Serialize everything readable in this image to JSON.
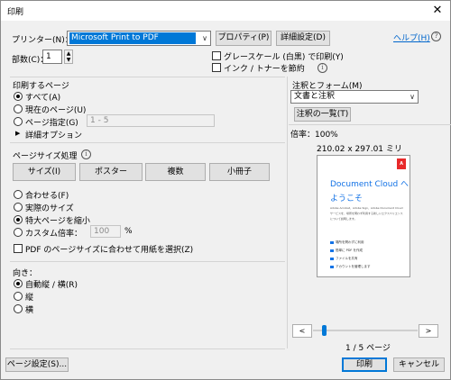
{
  "window": {
    "title": "印刷"
  },
  "printer": {
    "label": "プリンター(N)：",
    "selected": "Microsoft Print to PDF",
    "properties_button": "プロパティ(P)",
    "advanced_button": "詳細設定(D)",
    "help_link": "ヘルプ(H)"
  },
  "copies": {
    "label": "部数(C)：",
    "value": "1"
  },
  "options": {
    "grayscale": "グレースケール (白黒) で印刷(Y)",
    "save_ink": "インク / トナーを節約"
  },
  "pages_to_print": {
    "heading": "印刷するページ",
    "all": "すべて(A)",
    "current": "現在のページ(U)",
    "range": "ページ指定(G)",
    "range_placeholder": "1 - 5",
    "more_options": "詳細オプション"
  },
  "page_sizing": {
    "heading": "ページサイズ処理",
    "tabs": [
      "サイズ(I)",
      "ポスター",
      "複数",
      "小冊子"
    ],
    "fit": "合わせる(F)",
    "actual_size": "実際のサイズ",
    "shrink_oversized": "特大ページを縮小",
    "custom_scale": "カスタム倍率：",
    "custom_scale_value": "100",
    "percent": "%",
    "choose_paper": "PDF のページサイズに合わせて用紙を選択(Z)"
  },
  "orientation": {
    "heading": "向き：",
    "auto": "自動縦 / 横(R)",
    "portrait": "縦",
    "landscape": "横"
  },
  "comments_forms": {
    "heading": "注釈とフォーム(M)",
    "selected": "文書と注釈",
    "summarize_button": "注釈の一覧(T)"
  },
  "preview": {
    "scale": "倍率：100%",
    "dimensions": "210.02 x 297.01 ミリ",
    "page_indicator": "1 / 5 ページ",
    "doc_title_line1": "Document Cloud へ",
    "doc_title_line2": "ようこそ",
    "doc_text1": "Adobe Acrobat、Adobe Sign、Adobe Document Cloud",
    "doc_text2": "サービスを、場所を問わず利用する新しいエクスペリエンス",
    "doc_text3": "について説明します。",
    "doc_items": [
      "場所を問わずに利用",
      "簡単に PDF を作成",
      "ファイルを共有",
      "アカウントを管理します"
    ],
    "prev_icon": "<",
    "next_icon": ">",
    "logo_text": "A"
  },
  "footer": {
    "page_setup": "ページ設定(S)...",
    "print": "印刷",
    "cancel": "キャンセル"
  },
  "colors": {
    "accent": "#0078d7",
    "link": "#0066cc",
    "adobe_red": "#e8292a"
  }
}
